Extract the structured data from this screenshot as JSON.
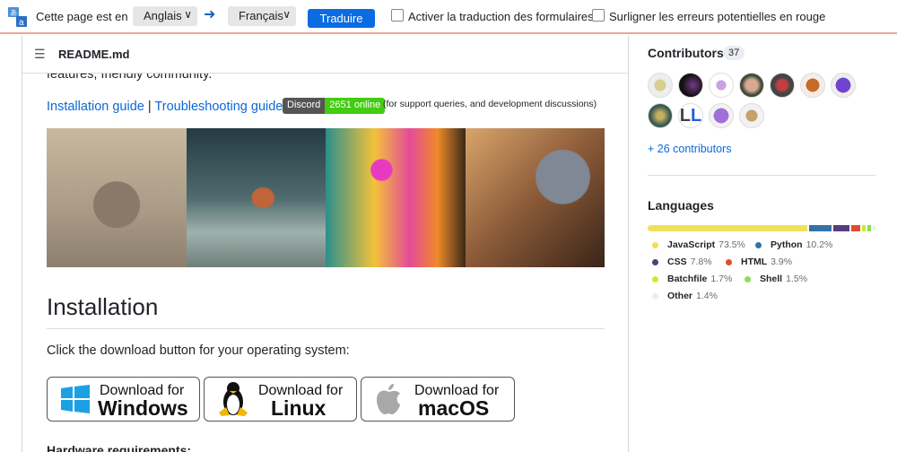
{
  "translate_bar": {
    "prefix": "Cette page est en",
    "source_lang": "Anglais",
    "target_lang": "Français",
    "translate_button": "Traduire",
    "option_forms": "Activer la traduction des formulaires",
    "option_errors": "Surligner les erreurs potentielles en rouge",
    "accent": "#0a6ce0"
  },
  "readme": {
    "filename": "README.md",
    "partial_text": "features, friendly community.",
    "link_install": "Installation guide",
    "sep": "|",
    "link_trouble": "Troubleshooting guide",
    "badge_label": "Discord",
    "badge_value": "2651 online",
    "badge_note": "(for support queries, and development discussions)",
    "heading": "Installation",
    "intro": "Click the download button for your operating system:",
    "downloads": [
      {
        "line1": "Download for",
        "line2": "Windows",
        "icon": "windows-icon"
      },
      {
        "line1": "Download for",
        "line2": "Linux",
        "icon": "linux-tux-icon"
      },
      {
        "line1": "Download for",
        "line2": "macOS",
        "icon": "apple-icon"
      }
    ],
    "hardware": "Hardware requirements:"
  },
  "sidebar": {
    "contributors_title": "Contributors",
    "contributors_count": "37",
    "more_contributors": "+ 26 contributors",
    "languages_title": "Languages",
    "languages": [
      {
        "name": "JavaScript",
        "pct": "73.5%",
        "value": 73.5,
        "color": "#f1e05a"
      },
      {
        "name": "Python",
        "pct": "10.2%",
        "value": 10.2,
        "color": "#3572a5"
      },
      {
        "name": "CSS",
        "pct": "7.8%",
        "value": 7.8,
        "color": "#563d7c"
      },
      {
        "name": "HTML",
        "pct": "3.9%",
        "value": 3.9,
        "color": "#e34c26"
      },
      {
        "name": "Batchfile",
        "pct": "1.7%",
        "value": 1.7,
        "color": "#c1f12e"
      },
      {
        "name": "Shell",
        "pct": "1.5%",
        "value": 1.5,
        "color": "#89e051"
      },
      {
        "name": "Other",
        "pct": "1.4%",
        "value": 1.4,
        "color": "#ededed"
      }
    ]
  }
}
